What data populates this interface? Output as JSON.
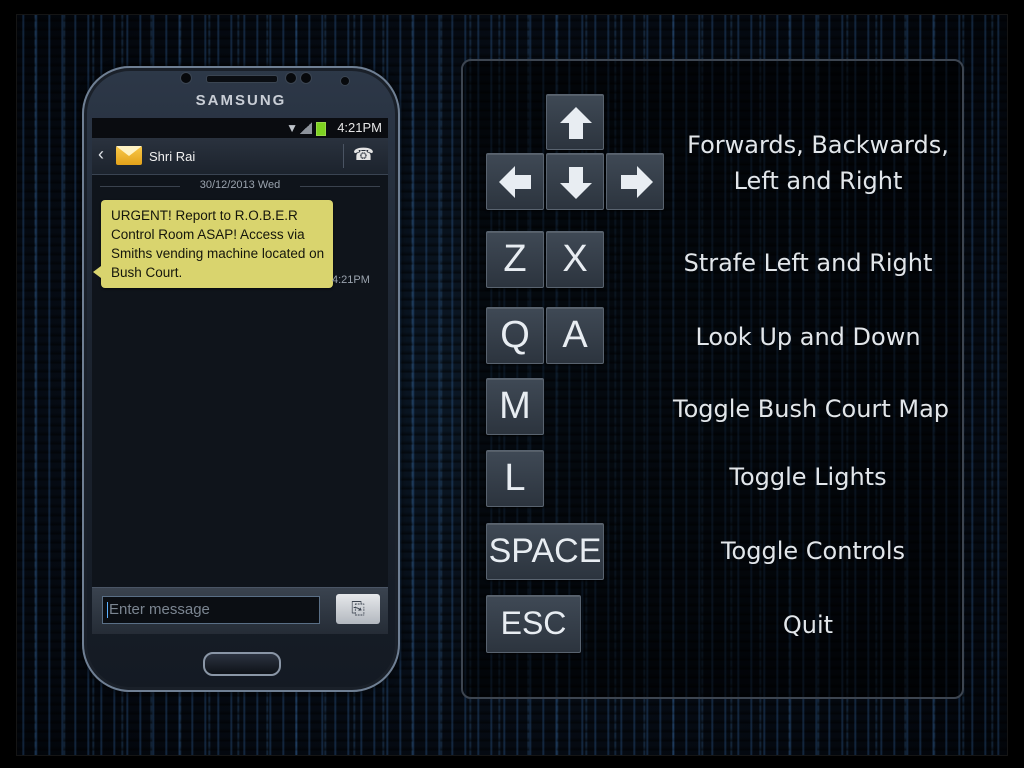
{
  "phone": {
    "brand": "SAMSUNG",
    "status_time": "4:21PM",
    "contact_name": "Shri Rai",
    "date_separator": "30/12/2013 Wed",
    "message_text": "URGENT! Report to R.O.B.E.R Control Room ASAP! Access via Smiths vending machine located on Bush Court.",
    "message_time": "4:21PM",
    "input_placeholder": "Enter message"
  },
  "controls": [
    {
      "keys": [
        "up-arrow",
        "left-arrow",
        "down-arrow",
        "right-arrow"
      ],
      "label": "Forwards, Backwards, Left and Right"
    },
    {
      "keys": [
        "Z",
        "X"
      ],
      "label": "Strafe Left and Right"
    },
    {
      "keys": [
        "Q",
        "A"
      ],
      "label": "Look Up and Down"
    },
    {
      "keys": [
        "M"
      ],
      "label": "Toggle Bush Court Map"
    },
    {
      "keys": [
        "L"
      ],
      "label": "Toggle Lights"
    },
    {
      "keys": [
        "SPACE"
      ],
      "label": "Toggle Controls"
    },
    {
      "keys": [
        "ESC"
      ],
      "label": "Quit"
    }
  ],
  "labels": {
    "movement_line1": "Forwards, Backwards,",
    "movement_line2": "Left and Right",
    "strafe": "Strafe Left and Right",
    "look": "Look Up and Down",
    "map": "Toggle Bush Court Map",
    "lights": "Toggle Lights",
    "controls": "Toggle Controls",
    "quit": "Quit"
  },
  "keys": {
    "z": "Z",
    "x": "X",
    "q": "Q",
    "a": "A",
    "m": "M",
    "l": "L",
    "space": "SPACE",
    "esc": "ESC"
  },
  "colors": {
    "bubble": "#d9d46e",
    "battery": "#7ed321",
    "key_face": "#37414c",
    "label_text": "#e2e6ea"
  }
}
